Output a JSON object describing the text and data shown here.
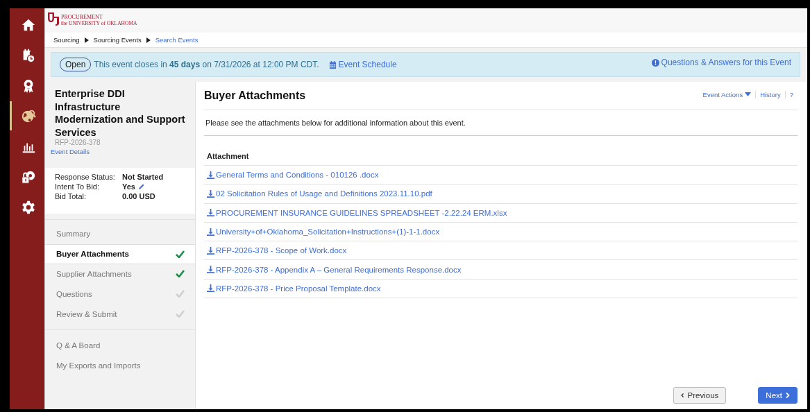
{
  "sidebar": {
    "items": [
      {
        "selected": false
      },
      {
        "selected": false
      },
      {
        "selected": false
      },
      {
        "selected": true
      },
      {
        "selected": false
      },
      {
        "selected": false
      },
      {
        "selected": false
      }
    ]
  },
  "header": {
    "logo_title": "PROCUREMENT",
    "logo_subtitle": "the UNIVERSITY of OKLAHOMA"
  },
  "breadcrumb": [
    {
      "label": "Sourcing",
      "link": false
    },
    {
      "label": "Sourcing Events",
      "link": false
    },
    {
      "label": "Search Events",
      "link": true
    }
  ],
  "banner": {
    "status": "Open",
    "message": "This event closes in **45 days** on 7/31/2026 at 12:00 PM CDT.",
    "schedule_link": "Event Schedule",
    "qa_link": "Questions & Answers for this Event"
  },
  "event": {
    "title": "Enterprise DDI Infrastructure Modernization and Support Services",
    "id": "RFP-2026-378",
    "details_link": "Event Details",
    "fields": [
      {
        "label": "Response Status:",
        "value": "Not Started",
        "editable": false
      },
      {
        "label": "Intent To Bid:",
        "value": "Yes",
        "editable": true
      },
      {
        "label": "Bid Total:",
        "value": "0.00 USD",
        "editable": false
      }
    ]
  },
  "steps": [
    {
      "label": "Summary",
      "kind": "plain",
      "selected": false
    },
    {
      "label": "Buyer Attachments",
      "kind": "step",
      "selected": true,
      "checked": true
    },
    {
      "label": "Supplier Attachments",
      "kind": "step",
      "selected": false,
      "checked": true
    },
    {
      "label": "Questions",
      "kind": "step",
      "selected": false,
      "checked": false
    },
    {
      "label": "Review & Submit",
      "kind": "step",
      "selected": false,
      "checked": false
    }
  ],
  "extra_links": [
    "Q & A Board",
    "My Exports and Imports"
  ],
  "content": {
    "title": "Buyer Attachments",
    "actions": [
      "Event Actions",
      "History",
      "?"
    ],
    "intro": "Please see the attachments below for additional information about this event.",
    "column": "Attachment",
    "attachments": [
      "General Terms and Conditions - 010126 .docx",
      "02 Solicitation Rules of Usage and Definitions 2023.11.10.pdf",
      "PROCUREMENT INSURANCE GUIDELINES SPREADSHEET -2.22.24 ERM.xlsx",
      "University+of+Oklahoma_Solicitation+Instructions+(1)-1-1.docx",
      "RFP-2026-378 - Scope of Work.docx",
      "RFP-2026-378 - Appendix A – General Requirements Response.docx",
      "RFP-2026-378 - Price Proposal Template.docx"
    ]
  },
  "buttons": {
    "previous": "Previous",
    "next": "Next"
  }
}
